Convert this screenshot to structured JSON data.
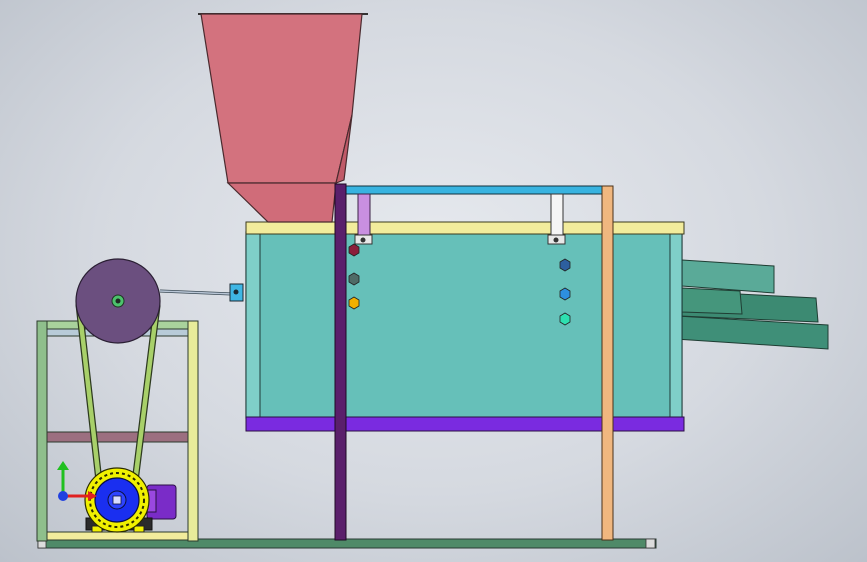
{
  "viewport": {
    "view": "side elevation",
    "colors": {
      "background": "#d5d9e0",
      "hopper": "#d3727e",
      "drum_body": "#66c0b9",
      "drum_top_rail": "#f2ec9c",
      "drum_bottom_rail": "#7a2be0",
      "purple_post": "#5a1f6b",
      "orange_post": "#f0b77f",
      "top_beam": "#38b3e0",
      "pulley": "#6b4f7f",
      "motor_ring": "#f0f000",
      "motor_hub": "#1a2ff0",
      "motor_body": "#7a2cc8",
      "frame_green": "#8fbf8c",
      "base_rail": "#4f8a68",
      "discharge_chute": "#3f8f78"
    },
    "axis_triad": {
      "x_color": "#e02020",
      "y_color": "#20c020",
      "z_color": "#2040e0"
    }
  }
}
